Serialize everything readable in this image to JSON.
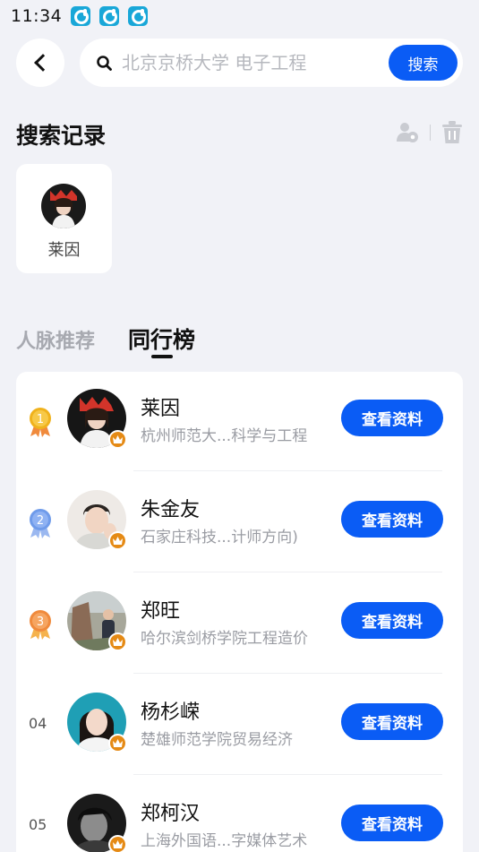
{
  "status_bar": {
    "time": "11:34",
    "icons": [
      "app-notification-icon",
      "app-notification-icon",
      "app-notification-icon"
    ]
  },
  "search": {
    "placeholder": "北京京桥大学 电子工程",
    "button_label": "搜索"
  },
  "history": {
    "title": "搜索记录",
    "items": [
      {
        "name": "莱因"
      }
    ]
  },
  "tabs": [
    {
      "label": "人脉推荐",
      "active": false
    },
    {
      "label": "同行榜",
      "active": true
    }
  ],
  "ranking": [
    {
      "rank": "1",
      "medal": "gold",
      "name": "莱因",
      "school": "杭州师范大...科学与工程",
      "button": "查看资料"
    },
    {
      "rank": "2",
      "medal": "silver",
      "name": "朱金友",
      "school": "石家庄科技...计师方向)",
      "button": "查看资料"
    },
    {
      "rank": "3",
      "medal": "bronze",
      "name": "郑旺",
      "school": "哈尔滨剑桥学院工程造价",
      "button": "查看资料"
    },
    {
      "rank": "04",
      "medal": null,
      "name": "杨杉嵘",
      "school": "楚雄师范学院贸易经济",
      "button": "查看资料"
    },
    {
      "rank": "05",
      "medal": null,
      "name": "郑柯汉",
      "school": "上海外国语...字媒体艺术",
      "button": "查看资料"
    }
  ],
  "colors": {
    "accent": "#0a5cf5",
    "background": "#f1f2f7",
    "gold": "#f0b21c",
    "silver": "#6f9bea",
    "bronze": "#f08a3c",
    "crown": "#e58a15"
  }
}
